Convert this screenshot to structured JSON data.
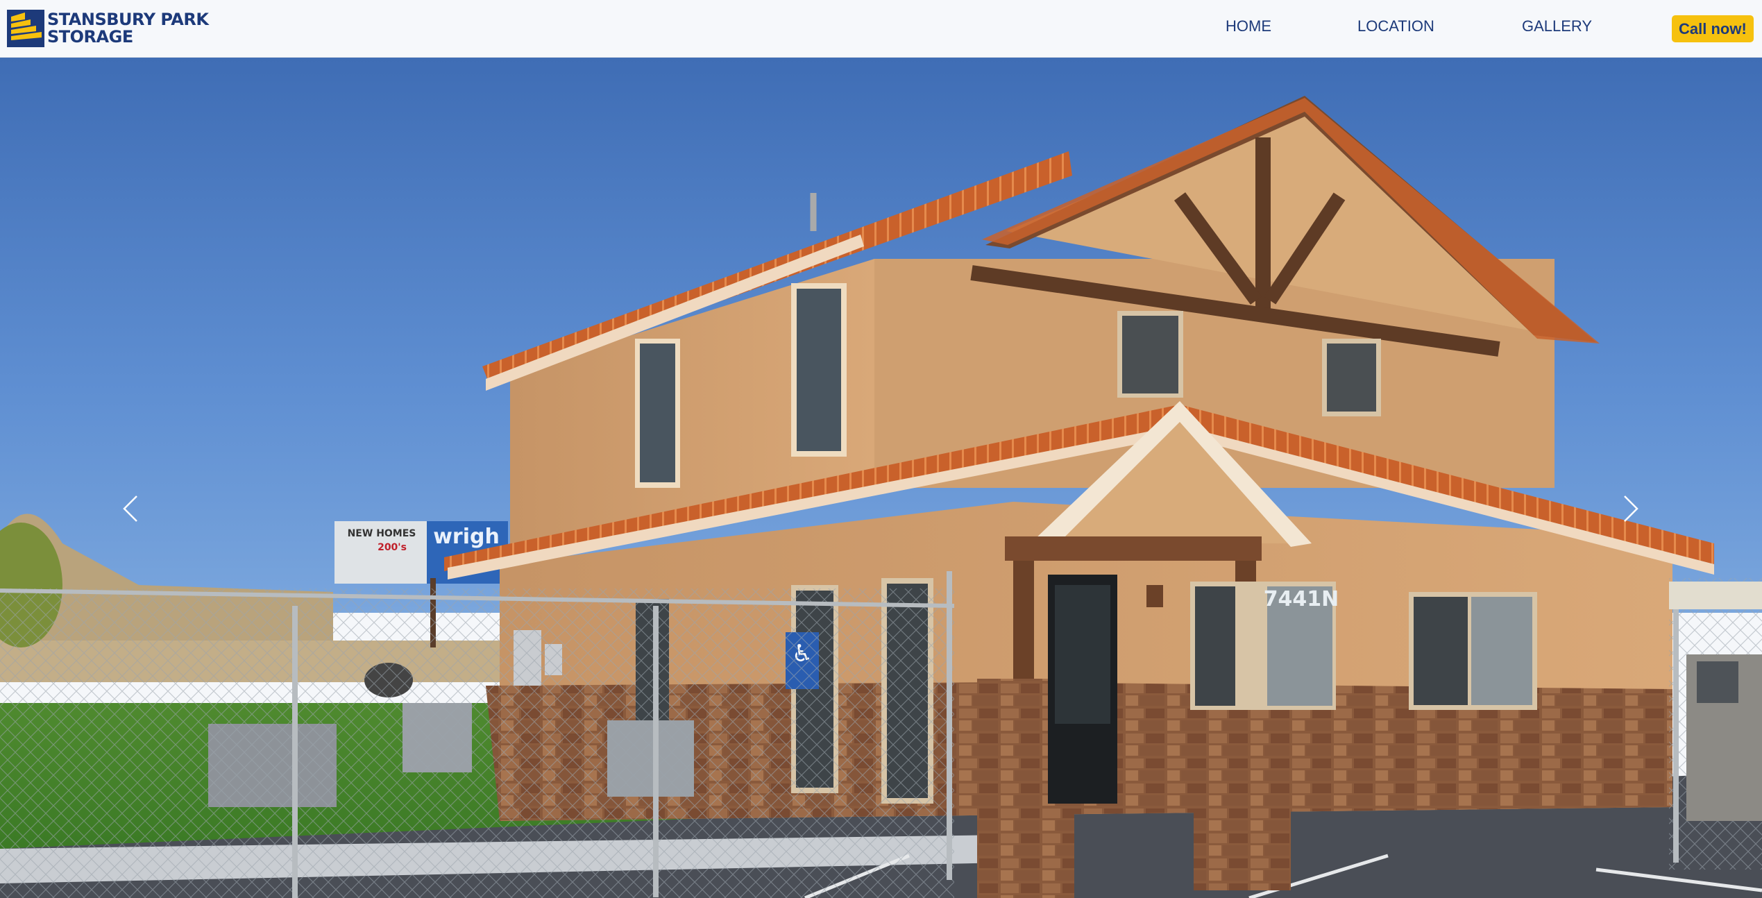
{
  "brand": {
    "line1": "STANSBURY PARK",
    "line2": "STORAGE",
    "logo_icon": "stripes-logo-icon",
    "colors": {
      "navy": "#1d3a7a",
      "gold": "#f6c10e"
    }
  },
  "nav": {
    "items": [
      {
        "label": "HOME"
      },
      {
        "label": "LOCATION"
      },
      {
        "label": "GALLERY"
      }
    ],
    "cta_label": "Call now!"
  },
  "hero": {
    "image_text": {
      "billboard_top": "NEW HOMES",
      "billboard_price": "200's",
      "billboard_brand": "wrigh",
      "address_number": "7441N"
    },
    "prev_icon": "chevron-left-icon",
    "next_icon": "chevron-right-icon"
  }
}
